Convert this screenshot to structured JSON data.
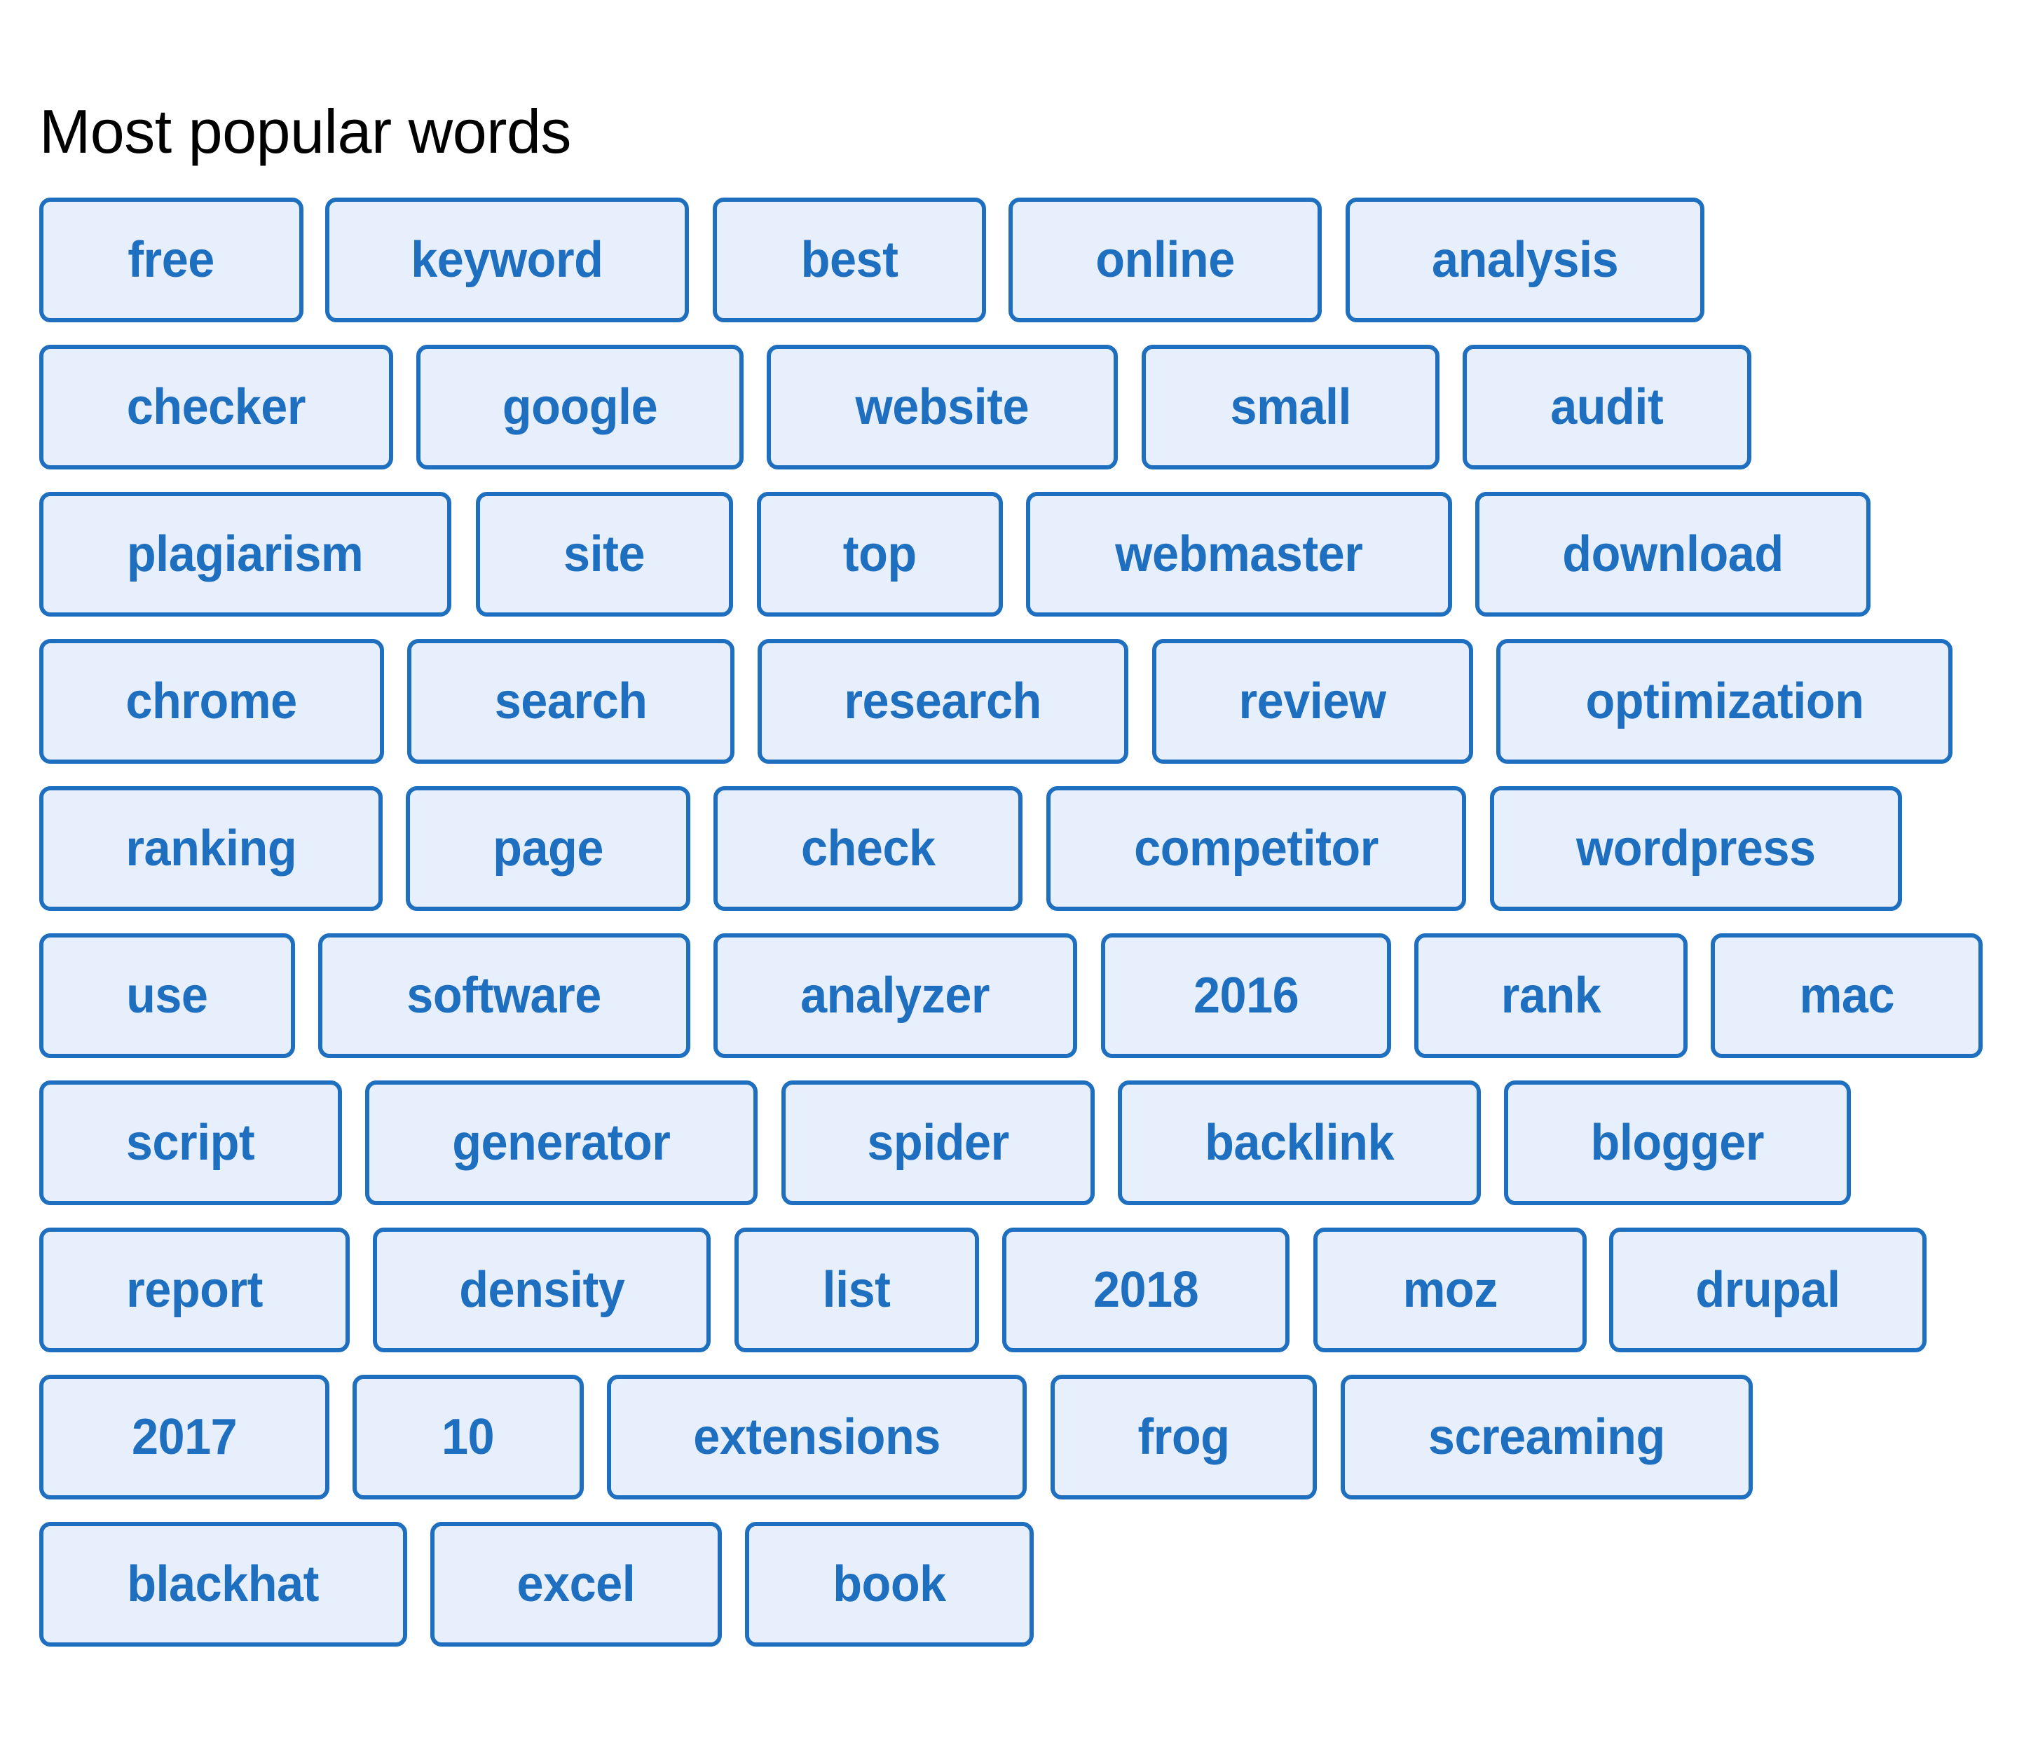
{
  "section": {
    "title": "Most popular words"
  },
  "colors": {
    "chip_border": "#1e6fbf",
    "chip_fill": "#e8effc",
    "chip_text": "#1e6fbf",
    "title_text": "#000000"
  },
  "rows": [
    [
      "free",
      "keyword",
      "best",
      "online",
      "analysis"
    ],
    [
      "checker",
      "google",
      "website",
      "small",
      "audit"
    ],
    [
      "plagiarism",
      "site",
      "top",
      "webmaster",
      "download"
    ],
    [
      "chrome",
      "search",
      "research",
      "review",
      "optimization"
    ],
    [
      "ranking",
      "page",
      "check",
      "competitor",
      "wordpress"
    ],
    [
      "use",
      "software",
      "analyzer",
      "2016",
      "rank",
      "mac"
    ],
    [
      "script",
      "generator",
      "spider",
      "backlink",
      "blogger"
    ],
    [
      "report",
      "density",
      "list",
      "2018",
      "moz",
      "drupal"
    ],
    [
      "2017",
      "10",
      "extensions",
      "frog",
      "screaming"
    ],
    [
      "blackhat",
      "excel",
      "book"
    ]
  ]
}
